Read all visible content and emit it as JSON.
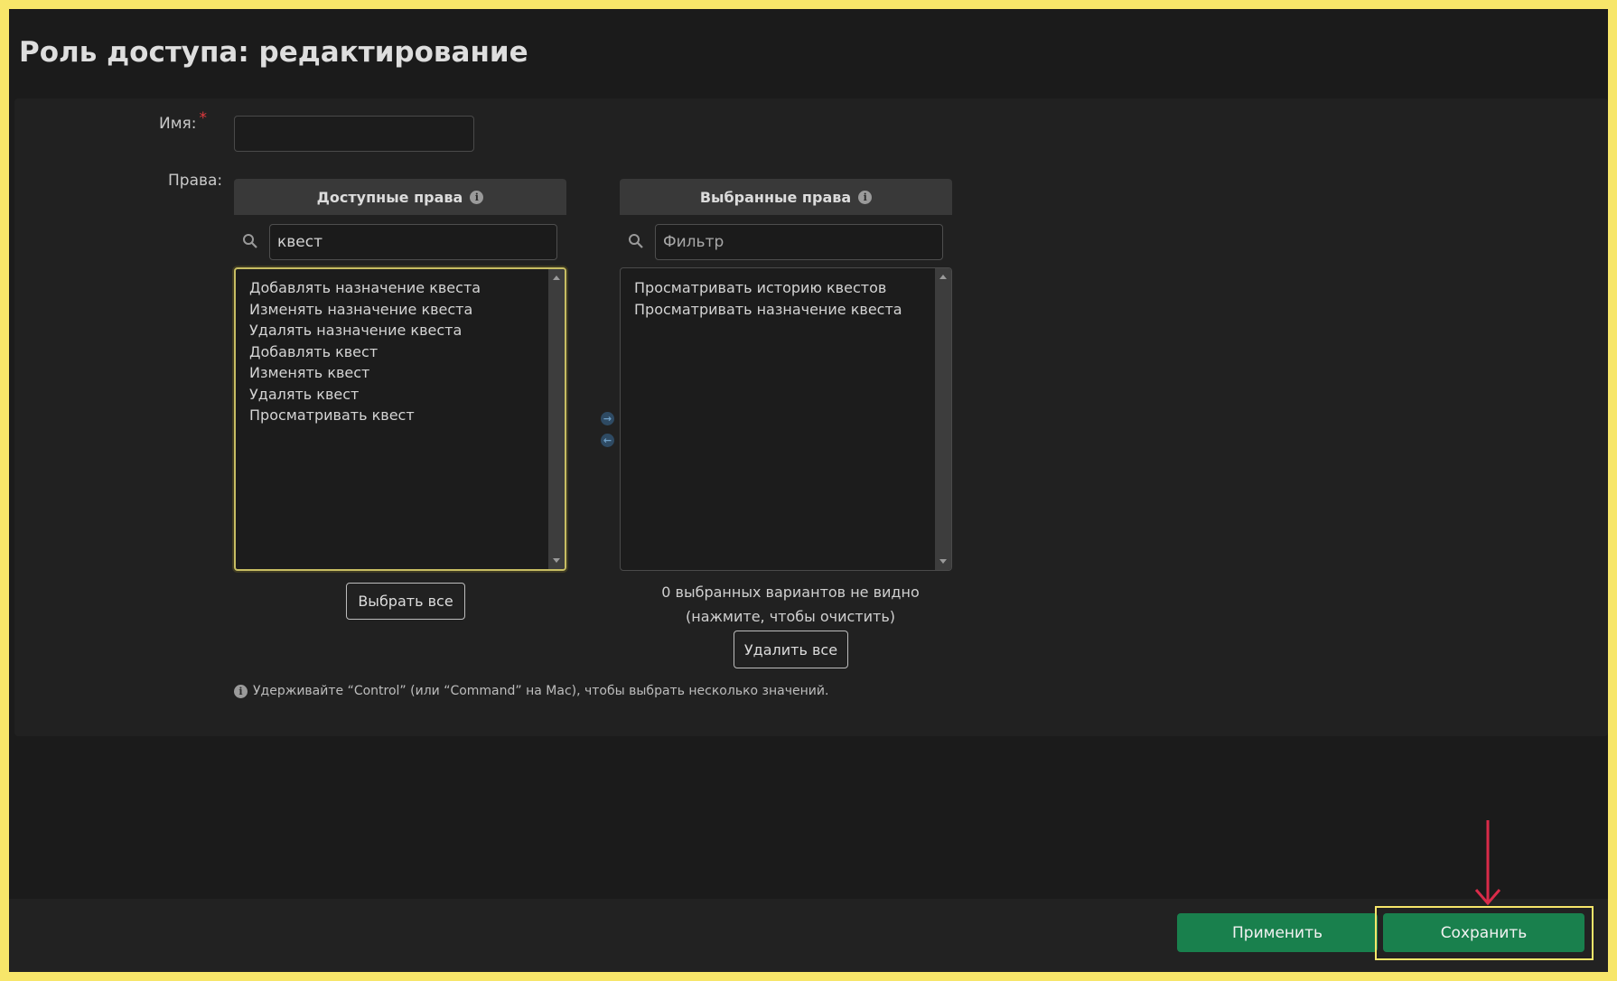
{
  "page": {
    "title": "Роль доступа: редактирование"
  },
  "form": {
    "name_label": "Имя:",
    "required_mark": "*",
    "name_value": "",
    "rights_label": "Права:"
  },
  "available": {
    "header": "Доступные права",
    "filter_value": "квест",
    "options": [
      "Добавлять назначение квеста",
      "Изменять назначение квеста",
      "Удалять назначение квеста",
      "Добавлять квест",
      "Изменять квест",
      "Удалять квест",
      "Просматривать квест"
    ],
    "select_all_label": "Выбрать все"
  },
  "chosen": {
    "header": "Выбранные права",
    "filter_placeholder": "Фильтр",
    "options": [
      "Просматривать историю квестов",
      "Просматривать назначение квеста"
    ],
    "hidden_note": "0 выбранных вариантов не видно (нажмите, чтобы очистить)",
    "remove_all_label": "Удалить все"
  },
  "help_text": "Удерживайте “Control” (или “Command” на Mac), чтобы выбрать несколько значений.",
  "footer": {
    "apply_label": "Применить",
    "save_label": "Сохранить"
  },
  "colors": {
    "accent_green": "#19804d",
    "highlight_yellow": "#f7e66a",
    "annotation_red": "#d92b49"
  },
  "icons": [
    "info-icon",
    "search-icon",
    "choose-arrow-icon",
    "remove-arrow-icon",
    "annotation-arrow-icon"
  ]
}
